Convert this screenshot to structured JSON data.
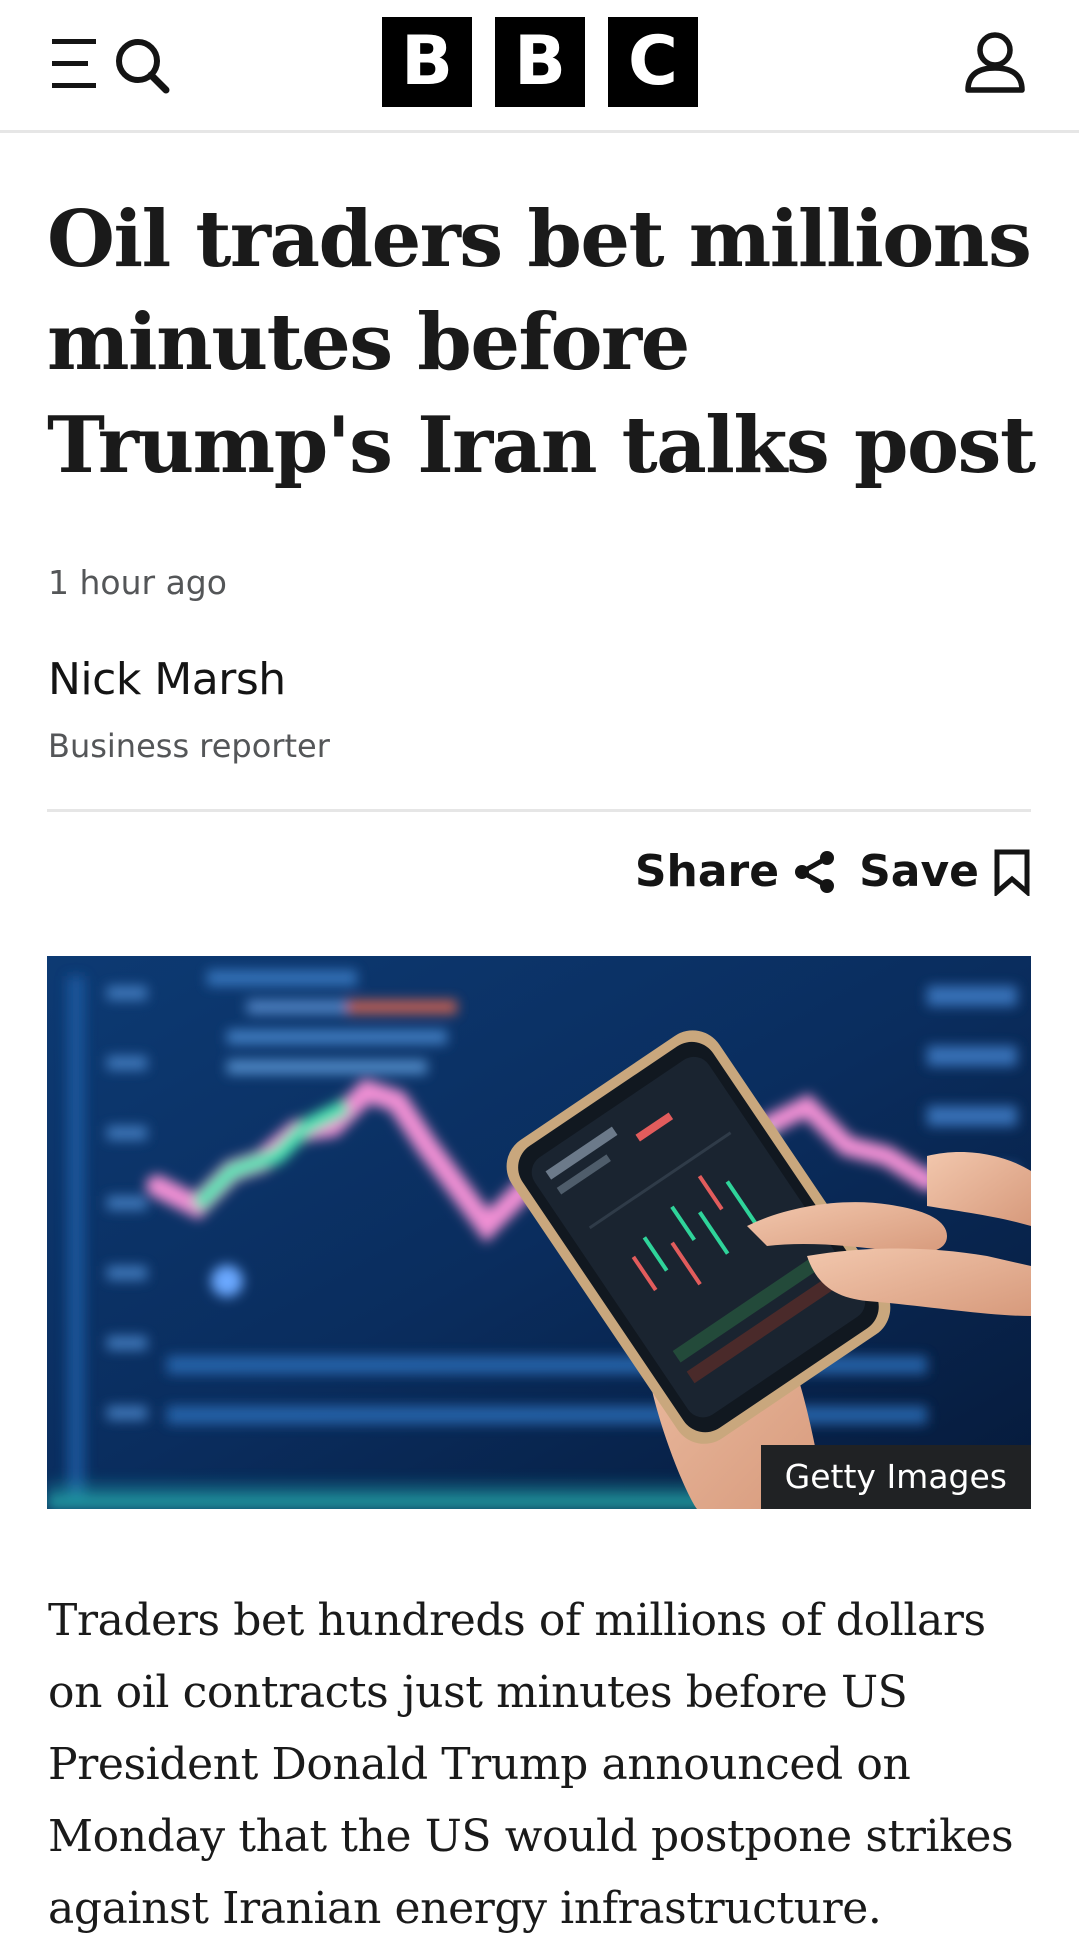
{
  "header": {
    "logo_letters": [
      "B",
      "B",
      "C"
    ],
    "icons": {
      "menu": "menu-icon",
      "search": "search-icon",
      "account": "account-icon"
    }
  },
  "article": {
    "headline": "Oil traders bet millions minutes before Trump's Iran talks post",
    "timestamp": "1 hour ago",
    "author_name": "Nick Marsh",
    "author_role": "Business reporter",
    "share_label": "Share",
    "save_label": "Save",
    "image_credit": "Getty Images",
    "body_paragraph": "Traders bet hundreds of millions of dollars on oil contracts just minutes before US President Donald Trump announced on Monday that the US would postpone strikes against Iranian energy infrastructure."
  },
  "colors": {
    "logo_bg": "#000000",
    "text_primary": "#141414",
    "text_secondary": "#545658",
    "divider": "#e6e6e6",
    "credit_bg": "#202224"
  }
}
